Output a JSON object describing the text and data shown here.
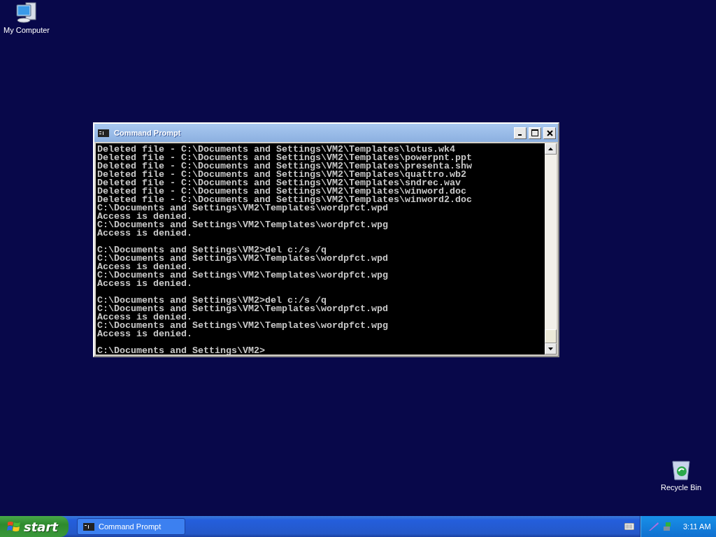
{
  "desktop_icons": [
    {
      "label": "My Computer",
      "kind": "computer"
    },
    {
      "label": "Recycle Bin",
      "kind": "recycle"
    }
  ],
  "window": {
    "title": "Command Prompt",
    "console_blocks": [
      [
        "Deleted file - C:\\Documents and Settings\\VM2\\Templates\\lotus.wk4",
        "Deleted file - C:\\Documents and Settings\\VM2\\Templates\\powerpnt.ppt",
        "Deleted file - C:\\Documents and Settings\\VM2\\Templates\\presenta.shw",
        "Deleted file - C:\\Documents and Settings\\VM2\\Templates\\quattro.wb2",
        "Deleted file - C:\\Documents and Settings\\VM2\\Templates\\sndrec.wav",
        "Deleted file - C:\\Documents and Settings\\VM2\\Templates\\winword.doc",
        "Deleted file - C:\\Documents and Settings\\VM2\\Templates\\winword2.doc",
        "C:\\Documents and Settings\\VM2\\Templates\\wordpfct.wpd",
        "Access is denied.",
        "C:\\Documents and Settings\\VM2\\Templates\\wordpfct.wpg",
        "Access is denied."
      ],
      [
        "C:\\Documents and Settings\\VM2>del c:/s /q",
        "C:\\Documents and Settings\\VM2\\Templates\\wordpfct.wpd",
        "Access is denied.",
        "C:\\Documents and Settings\\VM2\\Templates\\wordpfct.wpg",
        "Access is denied."
      ],
      [
        "C:\\Documents and Settings\\VM2>del c:/s /q",
        "C:\\Documents and Settings\\VM2\\Templates\\wordpfct.wpd",
        "Access is denied.",
        "C:\\Documents and Settings\\VM2\\Templates\\wordpfct.wpg",
        "Access is denied."
      ],
      [
        "C:\\Documents and Settings\\VM2>"
      ]
    ]
  },
  "taskbar": {
    "start_label": "start",
    "tasks": [
      {
        "label": "Command Prompt",
        "selected": false
      }
    ],
    "clock": "3:11 AM"
  }
}
